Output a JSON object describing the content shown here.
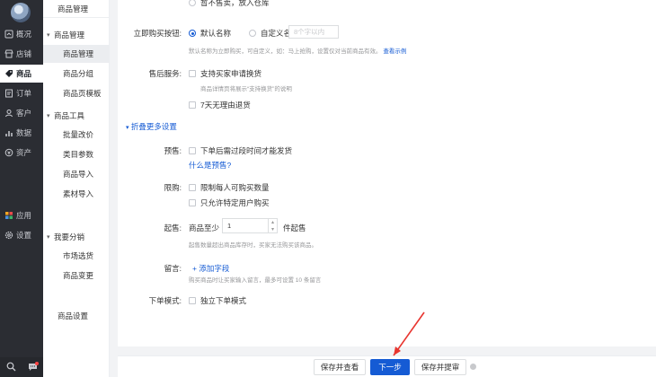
{
  "nav": {
    "items": [
      {
        "label": "概况",
        "icon": "overview-icon"
      },
      {
        "label": "店铺",
        "icon": "store-icon"
      },
      {
        "label": "商品",
        "icon": "tag-icon"
      },
      {
        "label": "订单",
        "icon": "order-icon"
      },
      {
        "label": "客户",
        "icon": "user-icon"
      },
      {
        "label": "数据",
        "icon": "chart-icon"
      },
      {
        "label": "资产",
        "icon": "asset-icon"
      }
    ],
    "apps_label": "应用",
    "settings_label": "设置",
    "active": "商品"
  },
  "subnav": {
    "top_label": "商品管理",
    "groups": [
      {
        "title": "商品管理",
        "items": [
          "商品管理",
          "商品分组",
          "商品页模板"
        ]
      },
      {
        "title": "商品工具",
        "items": [
          "批量改价",
          "类目参数",
          "商品导入",
          "素材导入"
        ]
      },
      {
        "title": "我要分销",
        "items": [
          "市场选货",
          "商品变更"
        ]
      }
    ],
    "footer_item": "商品设置",
    "active": "商品管理"
  },
  "form": {
    "top_cut_text": "暂不售卖，放入仓库",
    "buy_button": {
      "label": "立即购买按钮:",
      "opt_default": "默认名称",
      "opt_custom": "自定义名称",
      "custom_placeholder": "8个字以内",
      "hint": "默认名称为立即购买，可自定义，如：马上抢购，设置仅对当前商品有效。",
      "hint_link": "查看示例"
    },
    "after_sale": {
      "label": "售后服务:",
      "opt_exchange": "支持买家申请换货",
      "exchange_hint": "商品详情页将展示“支持换货”的说明",
      "opt_7day": "7天无理由退货"
    },
    "collapse_toggle": "折叠更多设置",
    "presale": {
      "label": "预售:",
      "opt": "下单后需过段时间才能发货",
      "link": "什么是预售?"
    },
    "limit": {
      "label": "限购:",
      "opt_limit_each": "限制每人可购买数量",
      "opt_specific_users": "只允许特定用户购买"
    },
    "min_buy": {
      "label": "起售:",
      "prefix": "商品至少",
      "value": "1",
      "suffix": "件起售",
      "hint": "起售数量超出商品库存时，买家无法购买该商品。"
    },
    "message": {
      "label": "留言:",
      "add_field": "+ 添加字段",
      "hint": "购买商品时让买家输入留言，最多可设置 10 条留言"
    },
    "order_mode": {
      "label": "下单模式:",
      "opt": "独立下单模式"
    }
  },
  "footer": {
    "save_view": "保存并查看",
    "next_step": "下一步",
    "save_list": "保存并提审"
  },
  "colors": {
    "accent": "#155bd4",
    "nav_bg": "#2b2d33",
    "arrow": "#e8352f"
  }
}
